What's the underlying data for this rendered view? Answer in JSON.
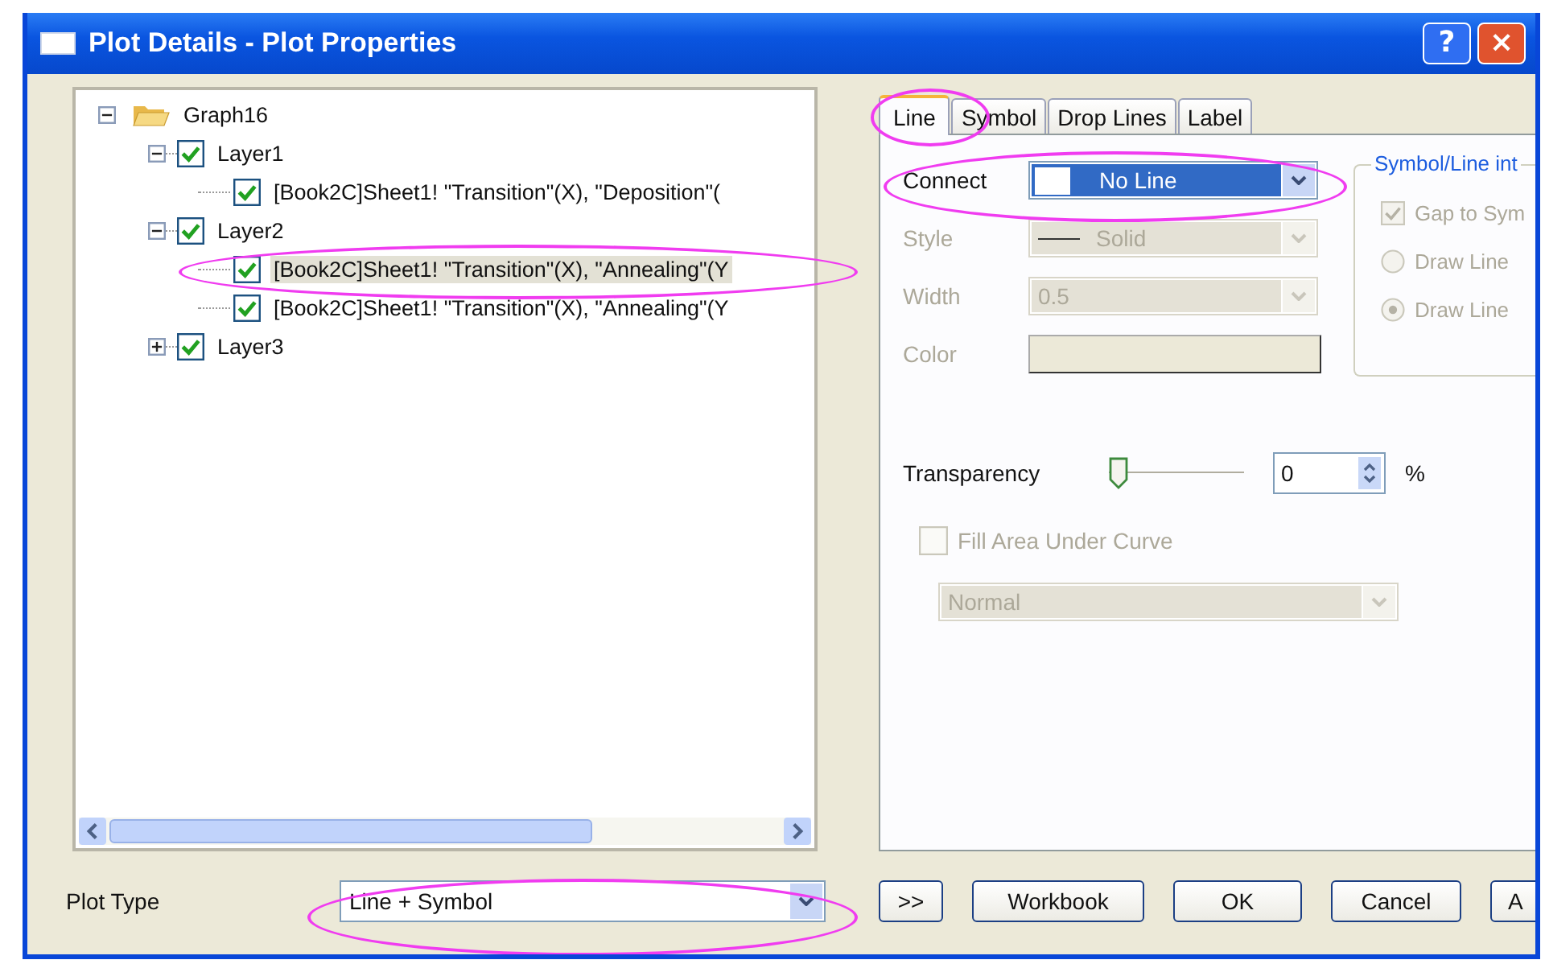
{
  "window": {
    "title": "Plot Details - Plot Properties",
    "buttons": [
      "?",
      "×"
    ]
  },
  "tree": {
    "items": [
      {
        "label": "Graph16",
        "kind": "folder",
        "expanded": true,
        "selected": false,
        "children": [
          {
            "label": "Layer1",
            "kind": "layer",
            "checked": true,
            "expanded": true,
            "selected": false,
            "children": [
              {
                "label": "[Book2C]Sheet1! \"Transition\"(X), \"Deposition\"(",
                "kind": "plot",
                "checked": true,
                "selected": false
              }
            ]
          },
          {
            "label": "Layer2",
            "kind": "layer",
            "checked": true,
            "expanded": true,
            "selected": false,
            "children": [
              {
                "label": "[Book2C]Sheet1! \"Transition\"(X), \"Annealing\"(Y",
                "kind": "plot",
                "checked": true,
                "selected": true
              },
              {
                "label": "[Book2C]Sheet1! \"Transition\"(X), \"Annealing\"(Y",
                "kind": "plot",
                "checked": true,
                "selected": false
              }
            ]
          },
          {
            "label": "Layer3",
            "kind": "layer",
            "checked": true,
            "expanded": false,
            "selected": false
          }
        ]
      }
    ]
  },
  "tabs": [
    {
      "label": "Line",
      "selected": true
    },
    {
      "label": "Symbol",
      "selected": false
    },
    {
      "label": "Drop Lines",
      "selected": false
    },
    {
      "label": "Label",
      "selected": false
    }
  ],
  "fields": [
    {
      "kind": "connect",
      "label": "Connect",
      "value": "No Line",
      "disabled": false,
      "focused": true
    },
    {
      "kind": "line-style",
      "label": "Style",
      "value": "Solid",
      "disabled": true,
      "focused": false
    },
    {
      "kind": "combo",
      "label": "Width",
      "value": "0.5",
      "disabled": true,
      "focused": false
    },
    {
      "kind": "color",
      "label": "Color",
      "disabled": true,
      "focused": false
    }
  ],
  "group": {
    "title": "Symbol/Line int",
    "options": [
      {
        "kind": "checkbox",
        "label": "Gap to Sym",
        "checked": true,
        "disabled": true
      },
      {
        "kind": "radio",
        "label": "Draw Line",
        "selected": false,
        "disabled": true
      },
      {
        "kind": "radio",
        "label": "Draw Line",
        "selected": true,
        "disabled": true
      }
    ]
  },
  "transparency": {
    "label": "Transparency",
    "level": 0,
    "value": "0",
    "unit": "%"
  },
  "fill": {
    "label": "Fill Area Under Curve",
    "checked": false,
    "disabled": true
  },
  "fill_mode": {
    "value": "Normal",
    "disabled": true
  },
  "plot_type": {
    "label": "Plot Type",
    "value": "Line + Symbol"
  },
  "buttons": [
    ">>",
    "Workbook",
    "OK",
    "Cancel",
    "A"
  ]
}
